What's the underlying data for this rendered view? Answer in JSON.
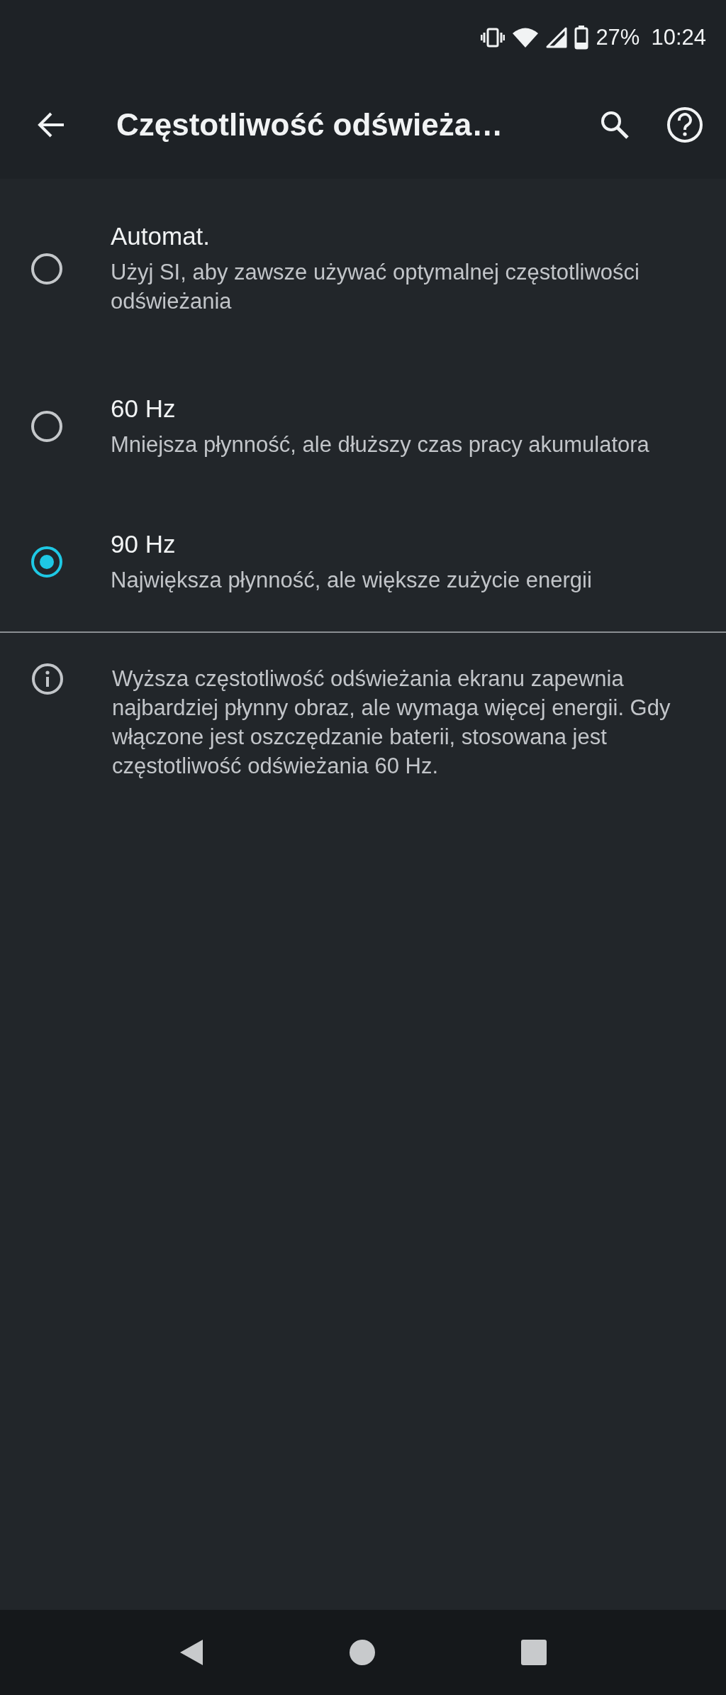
{
  "status_bar": {
    "battery": "27%",
    "time": "10:24"
  },
  "app_bar": {
    "title": "Częstotliwość odświeża…"
  },
  "options": [
    {
      "title": "Automat.",
      "summary": "Użyj SI, aby zawsze używać optymalnej częstotliwości odświeżania",
      "selected": false
    },
    {
      "title": "60 Hz",
      "summary": "Mniejsza płynność, ale dłuższy czas pracy akumulatora",
      "selected": false
    },
    {
      "title": "90 Hz",
      "summary": "Największa płynność, ale większe zużycie energii",
      "selected": true
    }
  ],
  "info": {
    "text": "Wyższa częstotliwość odświeżania ekranu zapewnia najbardziej płynny obraz, ale wymaga więcej energii. Gdy włączone jest oszczędzanie baterii, stosowana jest częstotliwość odświeżania 60 Hz."
  }
}
